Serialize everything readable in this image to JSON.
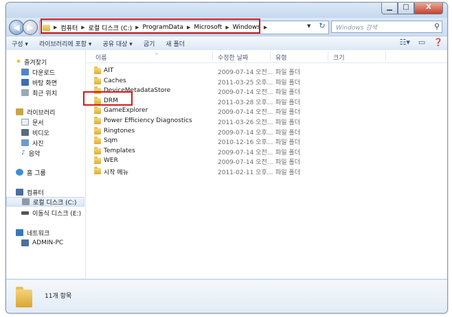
{
  "window": {
    "buttons": {
      "minimize": "▁",
      "maximize": "□",
      "close": "X"
    }
  },
  "navigation": {
    "back": "◀",
    "forward": "▶",
    "breadcrumbs": [
      "컴퓨터",
      "로컬 디스크 (C:)",
      "ProgramData",
      "Microsoft",
      "Windows"
    ],
    "address_dropdown": "▼",
    "refresh": "↻",
    "search_placeholder": "Windows 검색",
    "search_icon": "search-icon"
  },
  "toolbar": {
    "organize": "구성 ▾",
    "include_library": "라이브러리에 포함 ▾",
    "share_with": "공유 대상 ▾",
    "burn": "굽기",
    "new_folder": "새 폴더"
  },
  "sidebar": {
    "favorites_label": "즐겨찾기",
    "favorites": [
      "다운로드",
      "바탕 화면",
      "최근 위치"
    ],
    "libraries_label": "라이브러리",
    "libraries": [
      "문서",
      "비디오",
      "사진",
      "음악"
    ],
    "homegroup_label": "홈 그룹",
    "computer_label": "컴퓨터",
    "computer": [
      "로컬 디스크 (C:)",
      "이동식 디스크 (E:)"
    ],
    "network_label": "네트워크",
    "network": [
      "ADMIN-PC"
    ],
    "selected": "로컬 디스크 (C:)"
  },
  "columns": {
    "name": "이름",
    "date": "수정한 날짜",
    "type": "유형",
    "size": "크기"
  },
  "files": [
    {
      "name": "AIT",
      "date": "2009-07-14 오전...",
      "type": "파일 폴더"
    },
    {
      "name": "Caches",
      "date": "2011-03-25 오후...",
      "type": "파일 폴더"
    },
    {
      "name": "DeviceMetadataStore",
      "date": "2009-07-14 오전...",
      "type": "파일 폴더"
    },
    {
      "name": "DRM",
      "date": "2011-03-28 오후...",
      "type": "파일 폴더"
    },
    {
      "name": "GameExplorer",
      "date": "2009-07-14 오전...",
      "type": "파일 폴더"
    },
    {
      "name": "Power Efficiency Diagnostics",
      "date": "2011-03-26 오전...",
      "type": "파일 폴더"
    },
    {
      "name": "Ringtones",
      "date": "2009-07-14 오후...",
      "type": "파일 폴더"
    },
    {
      "name": "Sqm",
      "date": "2010-12-16 오후...",
      "type": "파일 폴더"
    },
    {
      "name": "Templates",
      "date": "2009-07-14 오전...",
      "type": "파일 폴더"
    },
    {
      "name": "WER",
      "date": "2009-07-14 오전...",
      "type": "파일 폴더"
    },
    {
      "name": "시작 메뉴",
      "date": "2011-02-11 오후...",
      "type": "파일 폴더"
    }
  ],
  "status": {
    "item_count": "11개 항목"
  },
  "colors": {
    "highlight": "#d11a1a",
    "folder": "#e0b23d"
  }
}
